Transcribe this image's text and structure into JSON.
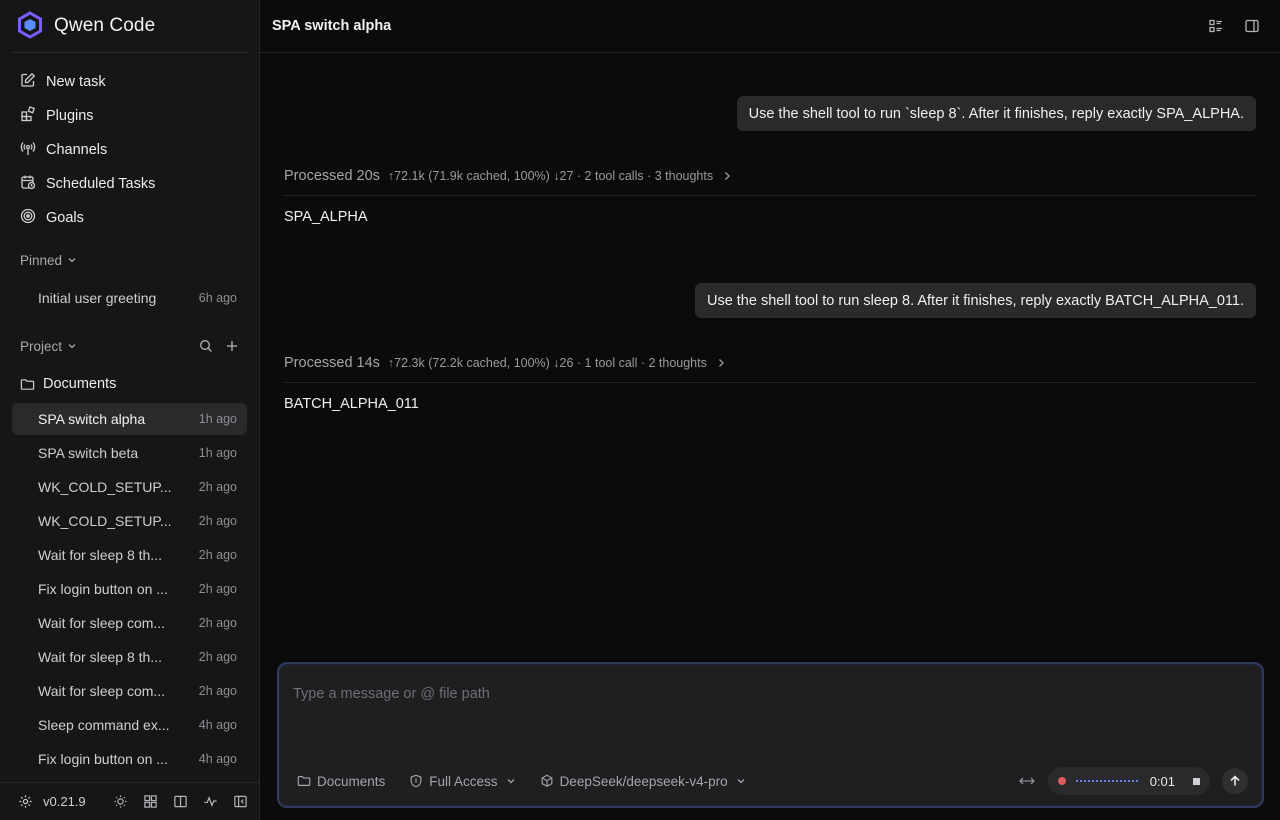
{
  "app": {
    "name": "Qwen Code",
    "version": "v0.21.9"
  },
  "nav": [
    {
      "label": "New task",
      "icon": "edit-icon"
    },
    {
      "label": "Plugins",
      "icon": "plugins-icon"
    },
    {
      "label": "Channels",
      "icon": "broadcast-icon"
    },
    {
      "label": "Scheduled Tasks",
      "icon": "calendar-clock-icon"
    },
    {
      "label": "Goals",
      "icon": "target-icon"
    }
  ],
  "pinned": {
    "label": "Pinned",
    "items": [
      {
        "title": "Initial user greeting",
        "ago": "6h ago"
      }
    ]
  },
  "project": {
    "label": "Project",
    "folder": "Documents",
    "items": [
      {
        "title": "SPA switch alpha",
        "ago": "1h ago"
      },
      {
        "title": "SPA switch beta",
        "ago": "1h ago"
      },
      {
        "title": "WK_COLD_SETUP...",
        "ago": "2h ago"
      },
      {
        "title": "WK_COLD_SETUP...",
        "ago": "2h ago"
      },
      {
        "title": "Wait for sleep 8 th...",
        "ago": "2h ago"
      },
      {
        "title": "Fix login button on ...",
        "ago": "2h ago"
      },
      {
        "title": "Wait for sleep com...",
        "ago": "2h ago"
      },
      {
        "title": "Wait for sleep 8 th...",
        "ago": "2h ago"
      },
      {
        "title": "Wait for sleep com...",
        "ago": "2h ago"
      },
      {
        "title": "Sleep command ex...",
        "ago": "4h ago"
      },
      {
        "title": "Fix login button on ...",
        "ago": "4h ago"
      }
    ]
  },
  "header": {
    "title": "SPA switch alpha"
  },
  "conversation": [
    {
      "user": "Use the shell tool to run `sleep 8`. After it finishes, reply exactly SPA_ALPHA.",
      "processed_label": "Processed 20s",
      "processed_stats": "↑72.1k (71.9k cached, 100%) ↓27 · 2 tool calls · 3 thoughts",
      "reply": "SPA_ALPHA"
    },
    {
      "user": "Use the shell tool to run sleep 8. After it finishes, reply exactly BATCH_ALPHA_011.",
      "processed_label": "Processed 14s",
      "processed_stats": "↑72.3k (72.2k cached, 100%) ↓26 · 1 tool call · 2 thoughts",
      "reply": "BATCH_ALPHA_011"
    }
  ],
  "composer": {
    "placeholder": "Type a message or @ file path",
    "folder": "Documents",
    "access": "Full Access",
    "model": "DeepSeek/deepseek-v4-pro",
    "timer": "0:01"
  },
  "colors": {
    "accent": "#7b5cff",
    "recording": "#e05b5b",
    "composer_border": "#2f3a5c"
  }
}
